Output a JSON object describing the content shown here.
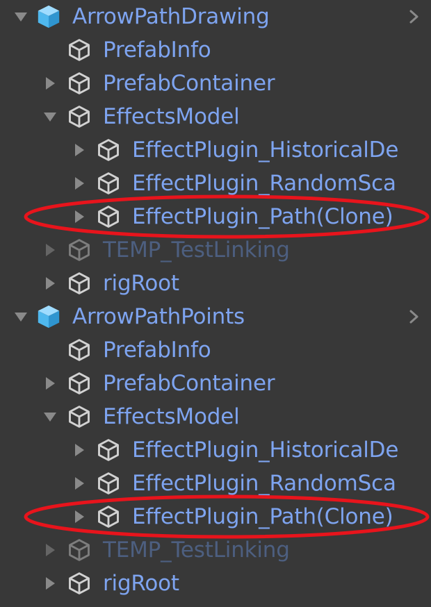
{
  "hierarchy": {
    "rows": [
      {
        "label": "ArrowPathDrawing",
        "depth": 0,
        "arrow": "expanded",
        "icon": "prefab-icon",
        "root": true,
        "disabled": false
      },
      {
        "label": "PrefabInfo",
        "depth": 1,
        "arrow": "none",
        "icon": "gameobject-icon",
        "root": false,
        "disabled": false
      },
      {
        "label": "PrefabContainer",
        "depth": 1,
        "arrow": "collapsed",
        "icon": "gameobject-icon",
        "root": false,
        "disabled": false
      },
      {
        "label": "EffectsModel",
        "depth": 1,
        "arrow": "expanded",
        "icon": "gameobject-icon",
        "root": false,
        "disabled": false
      },
      {
        "label": "EffectPlugin_HistoricalDe",
        "depth": 2,
        "arrow": "collapsed",
        "icon": "gameobject-icon",
        "root": false,
        "disabled": false
      },
      {
        "label": "EffectPlugin_RandomSca",
        "depth": 2,
        "arrow": "collapsed",
        "icon": "gameobject-icon",
        "root": false,
        "disabled": false
      },
      {
        "label": "EffectPlugin_Path(Clone)",
        "depth": 2,
        "arrow": "collapsed",
        "icon": "gameobject-icon",
        "root": false,
        "disabled": false,
        "highlighted": true
      },
      {
        "label": "TEMP_TestLinking",
        "depth": 1,
        "arrow": "collapsed",
        "icon": "gameobject-icon",
        "root": false,
        "disabled": true
      },
      {
        "label": "rigRoot",
        "depth": 1,
        "arrow": "collapsed",
        "icon": "gameobject-icon",
        "root": false,
        "disabled": false
      },
      {
        "label": "ArrowPathPoints",
        "depth": 0,
        "arrow": "expanded",
        "icon": "prefab-icon",
        "root": true,
        "disabled": false
      },
      {
        "label": "PrefabInfo",
        "depth": 1,
        "arrow": "none",
        "icon": "gameobject-icon",
        "root": false,
        "disabled": false
      },
      {
        "label": "PrefabContainer",
        "depth": 1,
        "arrow": "collapsed",
        "icon": "gameobject-icon",
        "root": false,
        "disabled": false
      },
      {
        "label": "EffectsModel",
        "depth": 1,
        "arrow": "expanded",
        "icon": "gameobject-icon",
        "root": false,
        "disabled": false
      },
      {
        "label": "EffectPlugin_HistoricalDe",
        "depth": 2,
        "arrow": "collapsed",
        "icon": "gameobject-icon",
        "root": false,
        "disabled": false
      },
      {
        "label": "EffectPlugin_RandomSca",
        "depth": 2,
        "arrow": "collapsed",
        "icon": "gameobject-icon",
        "root": false,
        "disabled": false
      },
      {
        "label": "EffectPlugin_Path(Clone)",
        "depth": 2,
        "arrow": "collapsed",
        "icon": "gameobject-icon",
        "root": false,
        "disabled": false,
        "highlighted": true
      },
      {
        "label": "TEMP_TestLinking",
        "depth": 1,
        "arrow": "collapsed",
        "icon": "gameobject-icon",
        "root": false,
        "disabled": true
      },
      {
        "label": "rigRoot",
        "depth": 1,
        "arrow": "collapsed",
        "icon": "gameobject-icon",
        "root": false,
        "disabled": false
      }
    ]
  },
  "colors": {
    "background": "#383838",
    "label": "#7ea4f0",
    "label_disabled": "#4d5f80",
    "prefab_icon": "#5ec4f5",
    "gameobject_icon": "#d2d2d2",
    "arrow": "#8a8a8a",
    "highlight": "#e8141c"
  }
}
